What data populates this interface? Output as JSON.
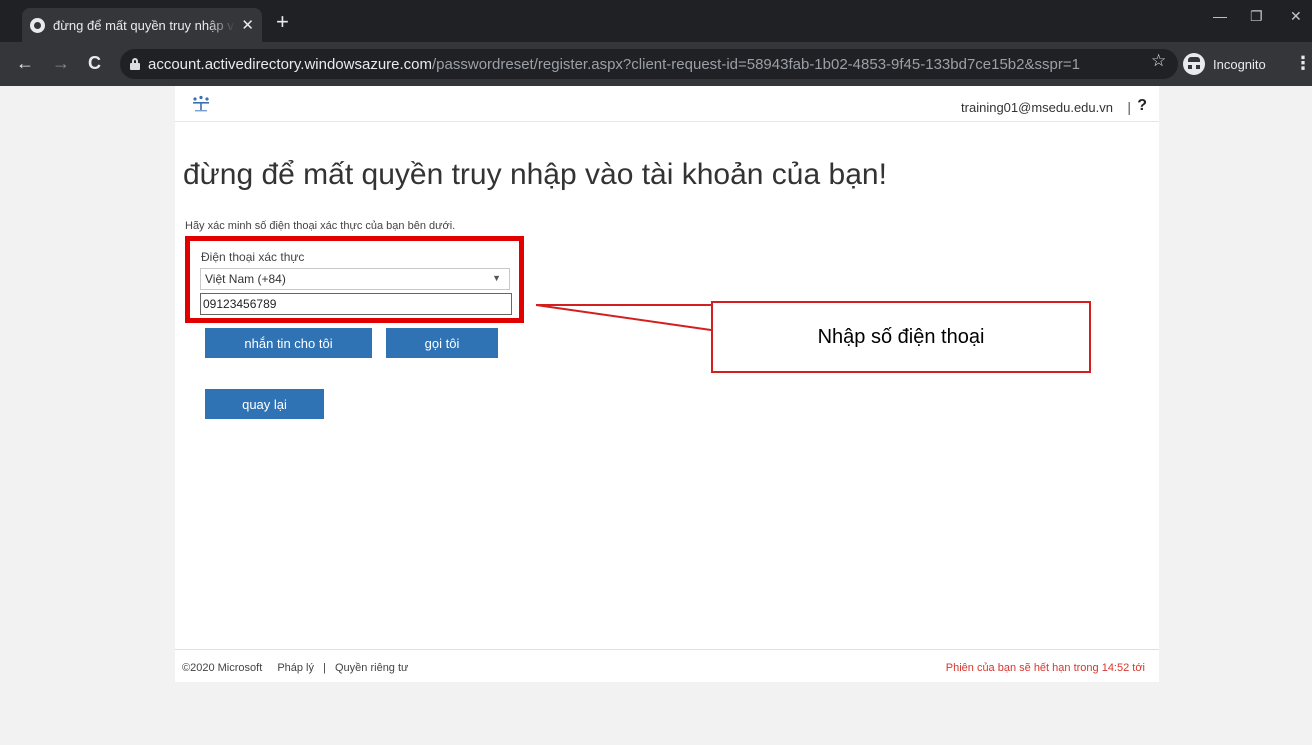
{
  "browser": {
    "tab_title": "đừng để mất quyền truy nhập vào tài khoản của bạn!",
    "tab_close": "✕",
    "new_tab": "+",
    "url_host": "account.activedirectory.windowsazure.com",
    "url_path": "/passwordreset/register.aspx?client-request-id=58943fab-1b02-4853-9f45-133bd7ce15b2&sspr=1",
    "incognito_label": "Incognito",
    "win_minimize": "—",
    "win_restore": "❐",
    "win_close": "✕",
    "back": "←",
    "forward": "→",
    "reload": "C",
    "star": "☆",
    "menu": "⋮"
  },
  "header": {
    "user": "training01@msedu.edu.vn",
    "separator": "|",
    "help": "?"
  },
  "main": {
    "title": "đừng để mất quyền truy nhập vào tài khoản của bạn!",
    "instruction": "Hãy xác minh số điện thoại xác thực của bạn bên dưới.",
    "phone_label": "Điện thoại xác thực",
    "country_selected": "Việt Nam (+84)",
    "chevron": "▼",
    "phone_value": "09123456789",
    "text_button": "nhắn tin cho tôi",
    "call_button": "gọi tôi",
    "back_button": "quay lại"
  },
  "footer": {
    "copyright": "©2020 Microsoft",
    "legal": "Pháp lý",
    "separator": "|",
    "privacy": "Quyền riêng tư",
    "session_notice": "Phiên của bạn sẽ hết hạn trong 14:52 tới"
  },
  "annotation": {
    "callout_text": "Nhập số điện thoại",
    "highlight_color": "#e00000"
  },
  "colors": {
    "accent_button": "#2f73b5",
    "chrome_dark": "#202124",
    "session_warning": "#d9352d"
  }
}
